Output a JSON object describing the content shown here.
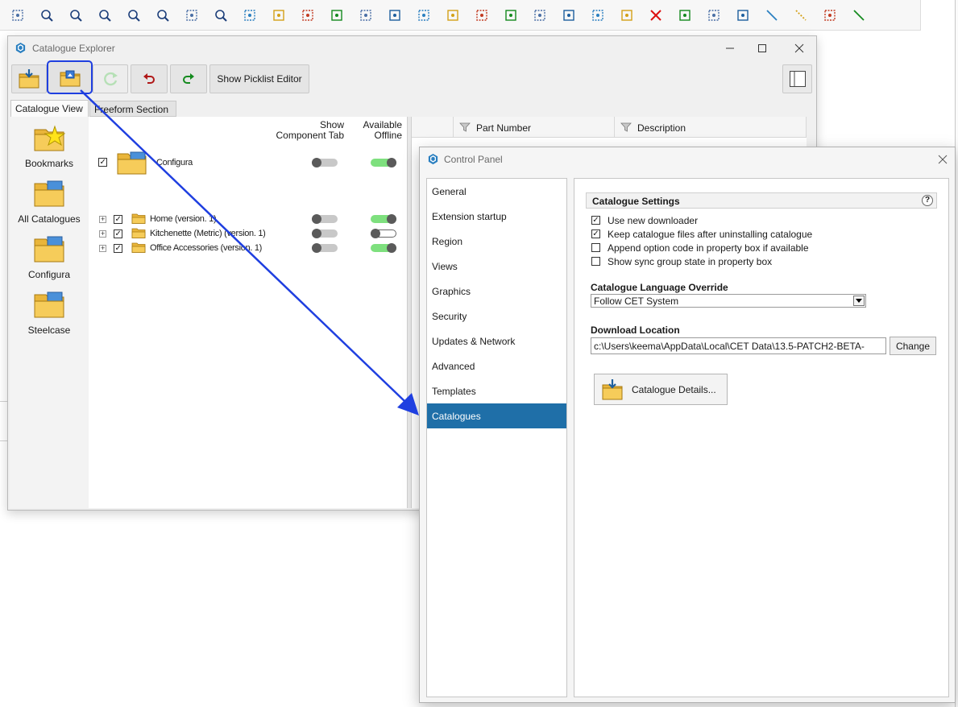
{
  "colors": {
    "accent_blue": "#1f6fa8",
    "annotation_blue": "#1f3fe0",
    "toggle_on": "#7ee07e",
    "toggle_off": "#c8c8c8"
  },
  "top_toolbar": {
    "icons": [
      "level-icon",
      "zoom-extents-alt-icon",
      "zoom-extents-icon",
      "zoom-in-icon",
      "zoom-out-icon",
      "zoom-window-icon",
      "pan-hand-icon",
      "zoom-selection-icon",
      "preview-window-icon",
      "frame-icon",
      "layer-icon",
      "paint-bucket-icon",
      "align-icon",
      "measure-icon",
      "sparkle-icon",
      "select-rect-icon",
      "select-lasso-icon",
      "note-icon",
      "arrow-up-icon",
      "connect-icon",
      "bounding-box-icon",
      "scale-icon",
      "delete-x-icon",
      "cut-icon",
      "group-icon",
      "path-icon",
      "line-icon",
      "dashed-line-icon",
      "ruler-icon",
      "dimension-icon"
    ]
  },
  "catalogue_explorer": {
    "title": "Catalogue Explorer",
    "picklist_button_label": "Show Picklist Editor",
    "tabs": [
      "Catalogue View",
      "Freeform Section"
    ],
    "sidebar_items": [
      "Bookmarks",
      "All Catalogues",
      "Configura",
      "Steelcase"
    ],
    "tree": {
      "header_show": "Show",
      "header_component_tab": "Component Tab",
      "header_available": "Available",
      "header_offline": "Offline",
      "root": {
        "label": "Configura",
        "checked": true,
        "show_component_tab": false,
        "available_offline": true
      },
      "children": [
        {
          "label": "Home (version. 1)",
          "checked": true,
          "show_component_tab": false,
          "available_offline": true
        },
        {
          "label": "Kitchenette (Metric) (version. 1)",
          "checked": true,
          "show_component_tab": false,
          "available_offline": false
        },
        {
          "label": "Office Accessories (version. 1)",
          "checked": true,
          "show_component_tab": false,
          "available_offline": true
        }
      ]
    },
    "grid_columns": [
      "Part Number",
      "Description"
    ]
  },
  "control_panel": {
    "title": "Control Panel",
    "nav_items": [
      "General",
      "Extension startup",
      "Region",
      "Views",
      "Graphics",
      "Security",
      "Updates & Network",
      "Advanced",
      "Templates",
      "Catalogues"
    ],
    "selected_nav": "Catalogues",
    "catalogue_settings": {
      "heading": "Catalogue Settings",
      "help_label": "?",
      "options": [
        {
          "label": "Use new downloader",
          "checked": true
        },
        {
          "label": "Keep catalogue files after uninstalling catalogue",
          "checked": true
        },
        {
          "label": "Append option code in property box if available",
          "checked": false
        },
        {
          "label": "Show sync group state in property box",
          "checked": false
        }
      ]
    },
    "language_override": {
      "label": "Catalogue Language Override",
      "selected": "Follow CET System"
    },
    "download_location": {
      "label": "Download Location",
      "value": "c:\\Users\\keema\\AppData\\Local\\CET Data\\13.5-PATCH2-BETA-",
      "change_label": "Change"
    },
    "catalogue_details_label": "Catalogue Details..."
  }
}
